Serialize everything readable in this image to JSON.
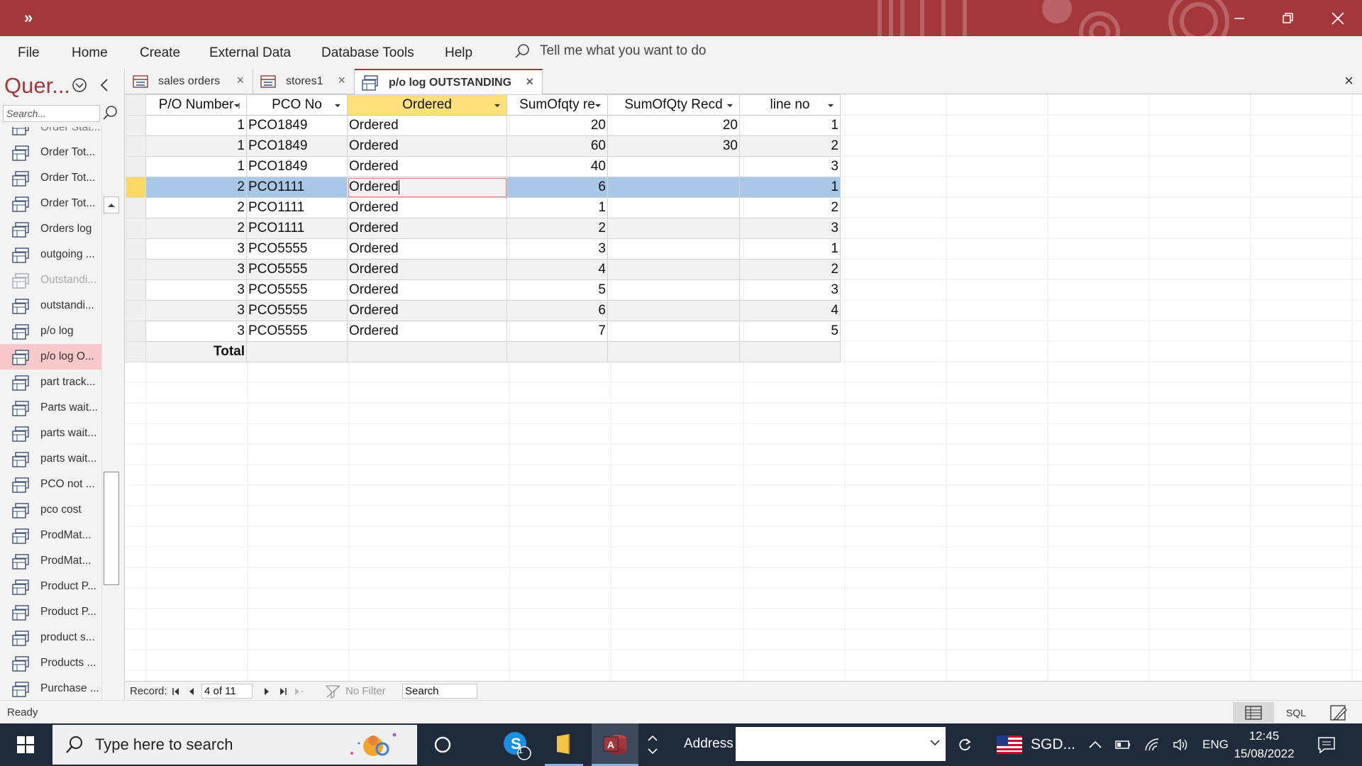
{
  "titlebar": {
    "quick_access": "»"
  },
  "menu": {
    "items": [
      "File",
      "Home",
      "Create",
      "External Data",
      "Database Tools",
      "Help"
    ],
    "tell_me": "Tell me what you want to do"
  },
  "nav": {
    "header": "Quer...",
    "search_placeholder": "Search...",
    "items": [
      {
        "label": "Order Stat..."
      },
      {
        "label": "Order Tot..."
      },
      {
        "label": "Order Tot..."
      },
      {
        "label": "Order Tot..."
      },
      {
        "label": "Orders log"
      },
      {
        "label": "outgoing ..."
      },
      {
        "label": "Outstandi..."
      },
      {
        "label": "outstandi..."
      },
      {
        "label": "p/o log"
      },
      {
        "label": "p/o log O..."
      },
      {
        "label": "part track..."
      },
      {
        "label": "Parts wait..."
      },
      {
        "label": "parts wait..."
      },
      {
        "label": "parts wait..."
      },
      {
        "label": "PCO  not ..."
      },
      {
        "label": "pco cost"
      },
      {
        "label": "ProdMat..."
      },
      {
        "label": "ProdMat..."
      },
      {
        "label": "Product P..."
      },
      {
        "label": "Product P..."
      },
      {
        "label": "product s..."
      },
      {
        "label": "Products ..."
      },
      {
        "label": "Purchase ..."
      }
    ]
  },
  "tabs": [
    {
      "label": "sales orders"
    },
    {
      "label": "stores1"
    },
    {
      "label": "p/o log OUTSTANDING"
    }
  ],
  "table": {
    "columns": [
      "P/O Number",
      "PCO No",
      "Ordered",
      "SumOfqty re",
      "SumOfQty Recd",
      "line no"
    ],
    "rows": [
      [
        "1",
        "PCO1849",
        "Ordered",
        "20",
        "20",
        "1"
      ],
      [
        "1",
        "PCO1849",
        "Ordered",
        "60",
        "30",
        "2"
      ],
      [
        "1",
        "PCO1849",
        "Ordered",
        "40",
        "",
        "3"
      ],
      [
        "2",
        "PCO1111",
        "Ordered",
        "6",
        "",
        "1"
      ],
      [
        "2",
        "PCO1111",
        "Ordered",
        "1",
        "",
        "2"
      ],
      [
        "2",
        "PCO1111",
        "Ordered",
        "2",
        "",
        "3"
      ],
      [
        "3",
        "PCO5555",
        "Ordered",
        "3",
        "",
        "1"
      ],
      [
        "3",
        "PCO5555",
        "Ordered",
        "4",
        "",
        "2"
      ],
      [
        "3",
        "PCO5555",
        "Ordered",
        "5",
        "",
        "3"
      ],
      [
        "3",
        "PCO5555",
        "Ordered",
        "6",
        "",
        "4"
      ],
      [
        "3",
        "PCO5555",
        "Ordered",
        "7",
        "",
        "5"
      ]
    ],
    "total_label": "Total",
    "current_row": 4
  },
  "recnav": {
    "label": "Record:",
    "position": "4 of 11",
    "filter": "No Filter",
    "search": "Search"
  },
  "status": {
    "text": "Ready",
    "sql": "SQL"
  },
  "taskbar": {
    "search_placeholder": "Type here to search",
    "skype_badge": "1",
    "access_letter": "A",
    "address_label": "Address",
    "currency": "SGD...",
    "lang": "ENG",
    "time": "12:45",
    "date": "15/08/2022"
  },
  "colors": {
    "accent": "#a4373a",
    "selected_row": "#a9c8e8",
    "header_highlight": "#ffe17a"
  }
}
